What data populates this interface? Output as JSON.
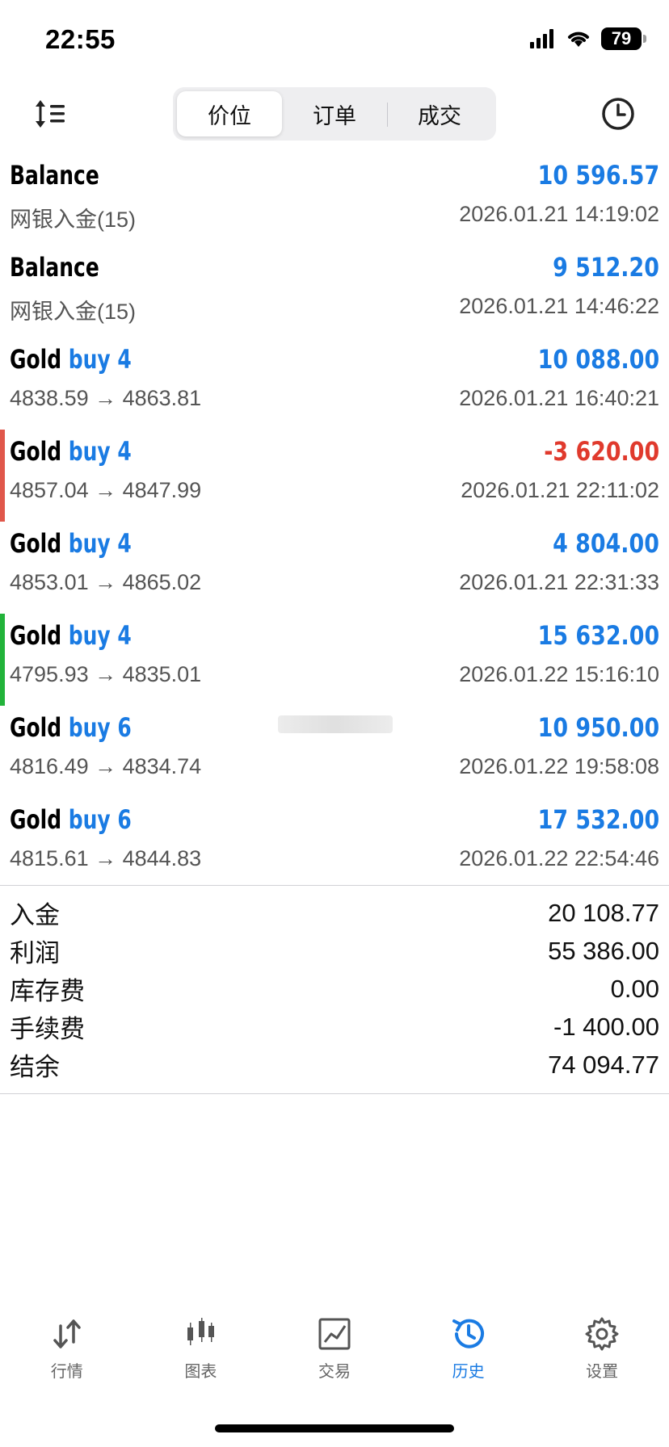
{
  "status": {
    "time": "22:55",
    "battery": "79"
  },
  "toolbar": {
    "segments": [
      "价位",
      "订单",
      "成交"
    ],
    "active_segment": "价位",
    "sort_icon": "sort-icon",
    "history_icon": "clock-icon"
  },
  "deals": [
    {
      "title": "Balance",
      "side": "",
      "amount": "10 596.57",
      "amount_sign": "positive",
      "sub": "网银入金(15)",
      "time": "2026.01.21 14:19:02",
      "indicator": ""
    },
    {
      "title": "Balance",
      "side": "",
      "amount": "9 512.20",
      "amount_sign": "positive",
      "sub": "网银入金(15)",
      "time": "2026.01.21 14:46:22",
      "indicator": ""
    },
    {
      "title": "Gold",
      "side": "buy 4",
      "amount": "10 088.00",
      "amount_sign": "positive",
      "sub": "4838.59 → 4863.81",
      "time": "2026.01.21 16:40:21",
      "indicator": ""
    },
    {
      "title": "Gold",
      "side": "buy 4",
      "amount": "-3 620.00",
      "amount_sign": "negative",
      "sub": "4857.04 → 4847.99",
      "time": "2026.01.21 22:11:02",
      "indicator": "#e0574b"
    },
    {
      "title": "Gold",
      "side": "buy 4",
      "amount": "4 804.00",
      "amount_sign": "positive",
      "sub": "4853.01 → 4865.02",
      "time": "2026.01.21 22:31:33",
      "indicator": ""
    },
    {
      "title": "Gold",
      "side": "buy 4",
      "amount": "15 632.00",
      "amount_sign": "positive",
      "sub": "4795.93 → 4835.01",
      "time": "2026.01.22 15:16:10",
      "indicator": "#22b33a"
    },
    {
      "title": "Gold",
      "side": "buy 6",
      "amount": "10 950.00",
      "amount_sign": "positive",
      "sub": "4816.49 → 4834.74",
      "time": "2026.01.22 19:58:08",
      "indicator": ""
    },
    {
      "title": "Gold",
      "side": "buy 6",
      "amount": "17 532.00",
      "amount_sign": "positive",
      "sub": "4815.61 → 4844.83",
      "time": "2026.01.22 22:54:46",
      "indicator": ""
    }
  ],
  "summary": [
    {
      "label": "入金",
      "value": "20 108.77"
    },
    {
      "label": "利润",
      "value": "55 386.00"
    },
    {
      "label": "库存费",
      "value": "0.00"
    },
    {
      "label": "手续费",
      "value": "-1 400.00"
    },
    {
      "label": "结余",
      "value": "74 094.77"
    }
  ],
  "tabs": [
    {
      "label": "行情",
      "icon": "quotes-icon",
      "active": false
    },
    {
      "label": "图表",
      "icon": "chart-icon",
      "active": false
    },
    {
      "label": "交易",
      "icon": "trade-icon",
      "active": false
    },
    {
      "label": "历史",
      "icon": "history-icon",
      "active": true
    },
    {
      "label": "设置",
      "icon": "gear-icon",
      "active": false
    }
  ],
  "colors": {
    "accent": "#1a7be3",
    "negative": "#e03a2d"
  }
}
